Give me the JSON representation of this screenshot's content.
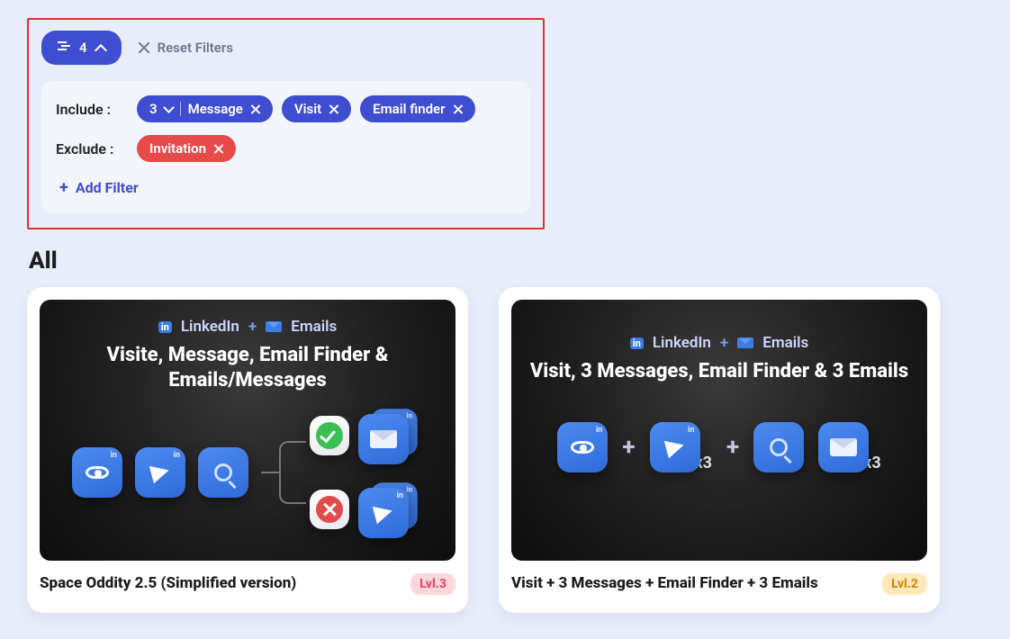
{
  "filter_panel": {
    "count": "4",
    "reset_label": "Reset Filters",
    "include_label": "Include :",
    "exclude_label": "Exclude :",
    "message_count": "3",
    "include_chips": [
      "Message",
      "Visit",
      "Email finder"
    ],
    "exclude_chips": [
      "Invitation"
    ],
    "add_filter_label": "Add Filter"
  },
  "section_title": "All",
  "cards": [
    {
      "header_linkedin": "LinkedIn",
      "header_plus": "+",
      "header_emails": "Emails",
      "hero_title": "Visite, Message, Email Finder & Emails/Messages",
      "title": "Space Oddity 2.5 (Simplified version)",
      "level_label": "Lvl.3",
      "level_class": "lvl3"
    },
    {
      "header_linkedin": "LinkedIn",
      "header_plus": "+",
      "header_emails": "Emails",
      "hero_title": "Visit, 3 Messages, Email Finder & 3 Emails",
      "multiplier": "x3",
      "title": "Visit + 3 Messages + Email Finder + 3 Emails",
      "level_label": "Lvl.2",
      "level_class": "lvl2"
    }
  ]
}
